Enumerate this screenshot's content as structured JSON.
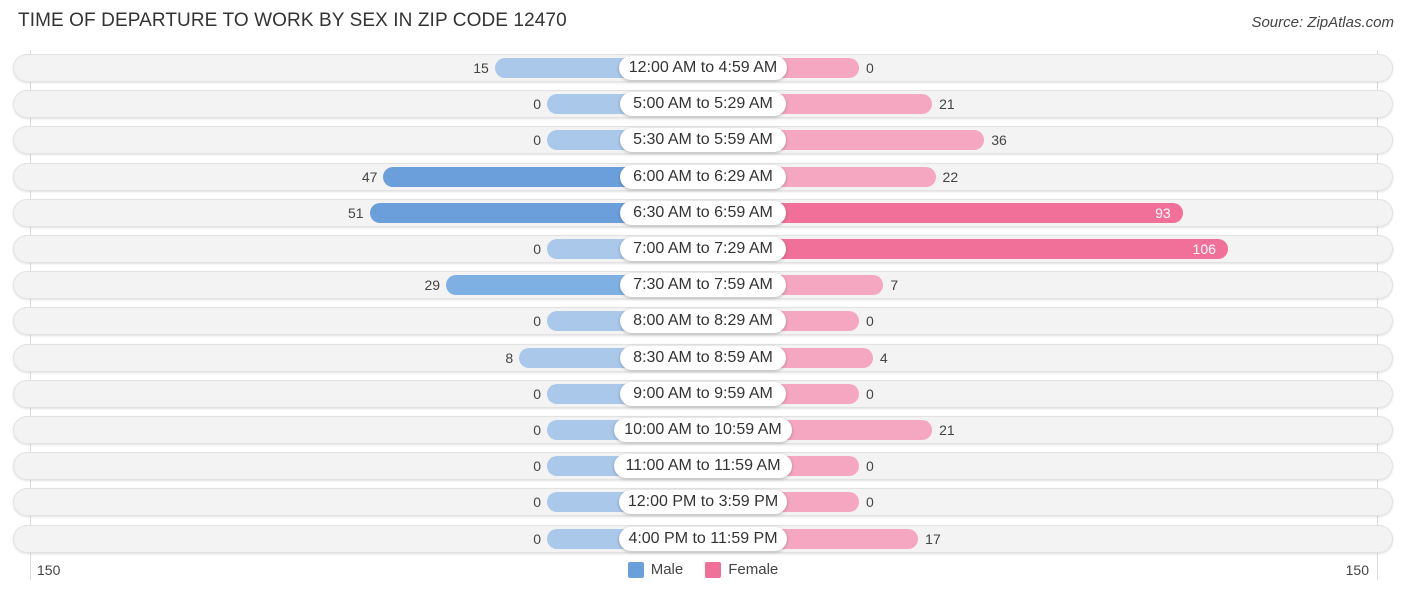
{
  "title": "TIME OF DEPARTURE TO WORK BY SEX IN ZIP CODE 12470",
  "source": "Source: ZipAtlas.com",
  "colors": {
    "male_strong": "#6a9fdb",
    "male_light": "#aac8ea",
    "female_strong": "#f0709a",
    "female_light": "#f5a6c0"
  },
  "chart_data": {
    "type": "bar",
    "orientation": "horizontal-diverging",
    "title": "TIME OF DEPARTURE TO WORK BY SEX IN ZIP CODE 12470",
    "categories": [
      "12:00 AM to 4:59 AM",
      "5:00 AM to 5:29 AM",
      "5:30 AM to 5:59 AM",
      "6:00 AM to 6:29 AM",
      "6:30 AM to 6:59 AM",
      "7:00 AM to 7:29 AM",
      "7:30 AM to 7:59 AM",
      "8:00 AM to 8:29 AM",
      "8:30 AM to 8:59 AM",
      "9:00 AM to 9:59 AM",
      "10:00 AM to 10:59 AM",
      "11:00 AM to 11:59 AM",
      "12:00 PM to 3:59 PM",
      "4:00 PM to 11:59 PM"
    ],
    "series": [
      {
        "name": "Male",
        "values": [
          15,
          0,
          0,
          47,
          51,
          0,
          29,
          0,
          8,
          0,
          0,
          0,
          0,
          0
        ]
      },
      {
        "name": "Female",
        "values": [
          0,
          21,
          36,
          22,
          93,
          106,
          7,
          0,
          4,
          0,
          21,
          0,
          0,
          17
        ]
      }
    ],
    "xlim": [
      -150,
      150
    ],
    "tick_labels": {
      "left": "150",
      "right": "150"
    },
    "legend": {
      "entries": [
        "Male",
        "Female"
      ],
      "placement": "bottom-center"
    },
    "grid": false
  }
}
